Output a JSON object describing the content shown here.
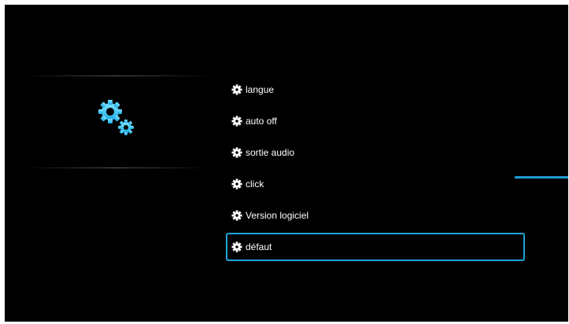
{
  "settings_menu": {
    "header_icon": "gears-icon",
    "accent_color": "#1ea6dc",
    "items": [
      {
        "label": "langue",
        "icon": "gear-icon"
      },
      {
        "label": "auto off",
        "icon": "gear-icon"
      },
      {
        "label": "sortie audio",
        "icon": "gear-icon"
      },
      {
        "label": "click",
        "icon": "gear-icon"
      },
      {
        "label": "Version logiciel",
        "icon": "gear-icon"
      },
      {
        "label": "défaut",
        "icon": "gear-icon",
        "selected": true
      }
    ]
  }
}
